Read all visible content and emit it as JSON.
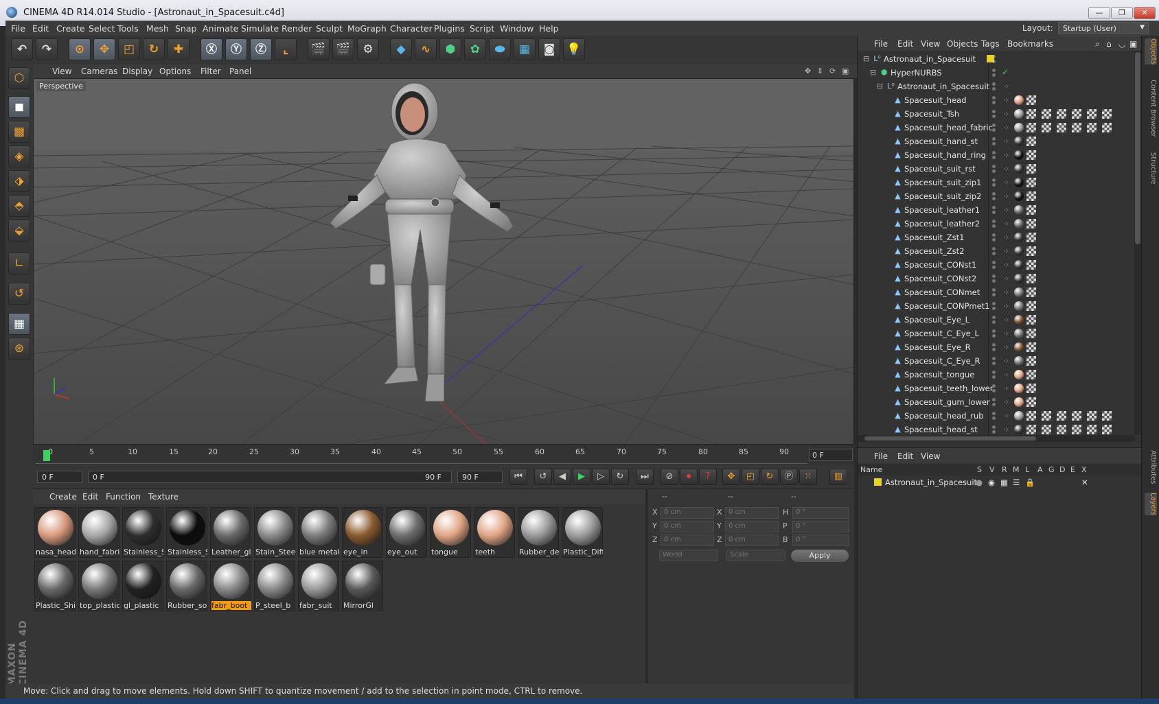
{
  "window": {
    "title": "CINEMA 4D R14.014 Studio - [Astronaut_in_Spacesuit.c4d]",
    "minimize": "—",
    "restore": "❐",
    "close": "✕"
  },
  "menubar": {
    "items": [
      "File",
      "Edit",
      "Create",
      "Select",
      "Tools",
      "Mesh",
      "Snap",
      "Animate",
      "Simulate",
      "Render",
      "Sculpt",
      "MoGraph",
      "Character",
      "Plugins",
      "Script",
      "Window",
      "Help"
    ],
    "layout_label": "Layout:",
    "layout_value": "Startup (User)"
  },
  "viewport": {
    "menu": [
      "View",
      "Cameras",
      "Display",
      "Options",
      "Filter",
      "Panel"
    ],
    "label": "Perspective"
  },
  "timeline": {
    "ticks": [
      "0",
      "5",
      "10",
      "15",
      "20",
      "25",
      "30",
      "35",
      "40",
      "45",
      "50",
      "55",
      "60",
      "65",
      "70",
      "75",
      "80",
      "85",
      "90"
    ],
    "current_frame": "0 F"
  },
  "transport": {
    "start": "0 F",
    "range_start": "0 F",
    "range_end": "90 F",
    "end": "90 F"
  },
  "material_manager": {
    "menu": [
      "Create",
      "Edit",
      "Function",
      "Texture"
    ],
    "materials": [
      {
        "name": "nasa_head",
        "color": "#d99a7e"
      },
      {
        "name": "hand_fabri",
        "color": "#a8a8a8"
      },
      {
        "name": "Stainless_S",
        "color": "#2e2e2e"
      },
      {
        "name": "Stainless_S",
        "color": "#0c0c0c"
      },
      {
        "name": "Leather_gl",
        "color": "#6a6a6a"
      },
      {
        "name": "Stain_Steel",
        "color": "#8a8a8a"
      },
      {
        "name": "blue metal",
        "color": "#7c7c7c"
      },
      {
        "name": "eye_in",
        "color": "#8a5a2e"
      },
      {
        "name": "eye_out",
        "color": "#6e6e6e"
      },
      {
        "name": "tongue",
        "color": "#e0a584"
      },
      {
        "name": "teeth",
        "color": "#e0a584"
      },
      {
        "name": "Rubber_de",
        "color": "#9a9a9a"
      },
      {
        "name": "Plastic_Diff",
        "color": "#9c9c9c"
      },
      {
        "name": "Plastic_Shi",
        "color": "#6a6a6a"
      },
      {
        "name": "top_plastic",
        "color": "#7a7a7a"
      },
      {
        "name": "gl_plastic",
        "color": "#222222"
      },
      {
        "name": "Rubber_so",
        "color": "#6a6a6a"
      },
      {
        "name": "fabr_boot",
        "color": "#8a8a8a"
      },
      {
        "name": "P_steel_b",
        "color": "#8a8a8a"
      },
      {
        "name": "fabr_suit",
        "color": "#9a9a9a"
      },
      {
        "name": "MirrorGl",
        "color": "#5a5a5a"
      }
    ],
    "selected": "fabr_boot"
  },
  "coordinates": {
    "top_labels": [
      "--",
      "--",
      "--"
    ],
    "rows": [
      {
        "a": "X",
        "av": "0 cm",
        "b": "X",
        "bv": "0 cm",
        "c": "H",
        "cv": "0 °"
      },
      {
        "a": "Y",
        "av": "0 cm",
        "b": "Y",
        "bv": "0 cm",
        "c": "P",
        "cv": "0 °"
      },
      {
        "a": "Z",
        "av": "0 cm",
        "b": "Z",
        "bv": "0 cm",
        "c": "B",
        "cv": "0 °"
      }
    ],
    "mode": "World",
    "scale": "Scale",
    "apply": "Apply"
  },
  "objects": {
    "menu": [
      "File",
      "Edit",
      "View",
      "Objects",
      "Tags",
      "Bookmarks"
    ],
    "rows": [
      {
        "name": "Astronaut_in_Spacesuit",
        "level": 0,
        "icon": "null-icon"
      },
      {
        "name": "HyperNURBS",
        "level": 1,
        "icon": "hypernurbs-icon"
      },
      {
        "name": "Astronaut_in_Spacesuit",
        "level": 2,
        "icon": "null-icon"
      },
      {
        "name": "Spacesuit_head",
        "level": 3,
        "mat": "#d99a7e",
        "tex": 1
      },
      {
        "name": "Spacesuit_Tsh",
        "level": 3,
        "mat": "#9a9a9a",
        "tex": 6
      },
      {
        "name": "Spacesuit_head_fabric",
        "level": 3,
        "mat": "#9a9a9a",
        "tex": 6
      },
      {
        "name": "Spacesuit_hand_st",
        "level": 3,
        "mat": "#333333",
        "tex": 1
      },
      {
        "name": "Spacesuit_hand_ring",
        "level": 3,
        "mat": "#111111",
        "tex": 1
      },
      {
        "name": "Spacesuit_suit_rst",
        "level": 3,
        "mat": "#333333",
        "tex": 1
      },
      {
        "name": "Spacesuit_suit_zip1",
        "level": 3,
        "mat": "#111111",
        "tex": 1
      },
      {
        "name": "Spacesuit_suit_zip2",
        "level": 3,
        "mat": "#111111",
        "tex": 1
      },
      {
        "name": "Spacesuit_leather1",
        "level": 3,
        "mat": "#666666",
        "tex": 1
      },
      {
        "name": "Spacesuit_leather2",
        "level": 3,
        "mat": "#666666",
        "tex": 1
      },
      {
        "name": "Spacesuit_Zst1",
        "level": 3,
        "mat": "#333333",
        "tex": 1
      },
      {
        "name": "Spacesuit_Zst2",
        "level": 3,
        "mat": "#333333",
        "tex": 1
      },
      {
        "name": "Spacesuit_CONst1",
        "level": 3,
        "mat": "#333333",
        "tex": 1
      },
      {
        "name": "Spacesuit_CONst2",
        "level": 3,
        "mat": "#333333",
        "tex": 1
      },
      {
        "name": "Spacesuit_CONmet",
        "level": 3,
        "mat": "#777777",
        "tex": 1
      },
      {
        "name": "Spacesuit_CONPmet1",
        "level": 3,
        "mat": "#777777",
        "tex": 1
      },
      {
        "name": "Spacesuit_Eye_L",
        "level": 3,
        "mat": "#7a5030",
        "tex": 1
      },
      {
        "name": "Spacesuit_C_Eye_L",
        "level": 3,
        "mat": "#6e6e6e",
        "tex": 1
      },
      {
        "name": "Spacesuit_Eye_R",
        "level": 3,
        "mat": "#7a5030",
        "tex": 1
      },
      {
        "name": "Spacesuit_C_Eye_R",
        "level": 3,
        "mat": "#6e6e6e",
        "tex": 1
      },
      {
        "name": "Spacesuit_tongue",
        "level": 3,
        "mat": "#e0a584",
        "tex": 1
      },
      {
        "name": "Spacesuit_teeth_lower",
        "level": 3,
        "mat": "#e0a584",
        "tex": 1
      },
      {
        "name": "Spacesuit_gum_lower",
        "level": 3,
        "mat": "#e0a584",
        "tex": 1
      },
      {
        "name": "Spacesuit_head_rub",
        "level": 3,
        "mat": "#999999",
        "tex": 6
      },
      {
        "name": "Spacesuit_head_st",
        "level": 3,
        "mat": "#333333",
        "tex": 6
      }
    ]
  },
  "layers": {
    "menu": [
      "File",
      "Edit",
      "View"
    ],
    "columns": [
      "Name",
      "S",
      "V",
      "R",
      "M",
      "L",
      "A",
      "G",
      "D",
      "E",
      "X"
    ],
    "row_name": "Astronaut_in_Spacesuit"
  },
  "side_tabs": [
    "Objects",
    "Content Browser",
    "Structure",
    "Attributes",
    "Layers"
  ],
  "status": "Move: Click and drag to move elements. Hold down SHIFT to quantize movement / add to the selection in point mode, CTRL to remove.",
  "colors": {
    "accent": "#f39c12",
    "selection": "#f39c12",
    "layer_color": "#e8d420"
  }
}
